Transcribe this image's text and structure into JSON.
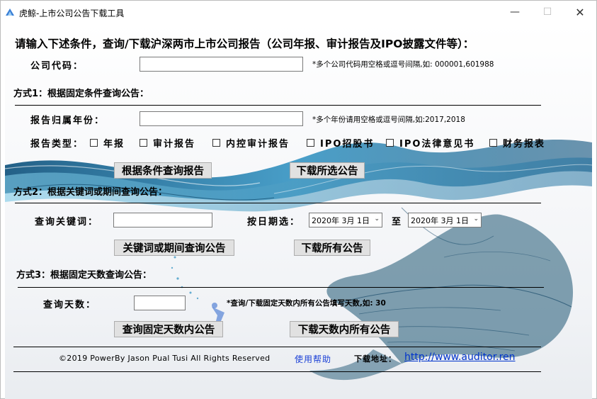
{
  "window": {
    "title": "虎鲸-上市公司公告下载工具",
    "icon": "app-icon",
    "controls": {
      "minimize": "—",
      "maximize": "☐",
      "close": "✕"
    }
  },
  "heading": "请输入下述条件，查询/下载沪深两市上市公司报告（公司年报、审计报告及IPO披露文件等）：",
  "company_code": {
    "label": "公司代码：",
    "value": "",
    "hint": "*多个公司代码用空格或逗号间隔,如: 000001,601988"
  },
  "method1": {
    "title": "方式1：根据固定条件查询公告：",
    "year_label": "报告归属年份：",
    "year_value": "",
    "year_hint": "*多个年份请用空格或逗号间隔,如:2017,2018",
    "type_label": "报告类型：",
    "types": [
      "年报",
      "审计报告",
      "内控审计报告",
      "IPO招股书",
      "IPO法律意见书",
      "财务报表"
    ],
    "query_button": "根据条件查询报告",
    "download_button": "下载所选公告"
  },
  "method2": {
    "title": "方式2：根据关键词或期间查询公告：",
    "keyword_label": "查询关键词：",
    "keyword_value": "",
    "date_label": "按日期选：",
    "date_from": "2020年 3月 1日",
    "date_to": "2020年 3月 1日",
    "to_label": "至",
    "query_button": "关键词或期间查询公告",
    "download_button": "下载所有公告"
  },
  "method3": {
    "title": "方式3：根据固定天数查询公告：",
    "days_label": "查询天数：",
    "days_value": "",
    "days_hint": "*查询/下载固定天数内所有公告填写天数,如: 30",
    "query_button": "查询固定天数内公告",
    "download_button": "下载天数内所有公告"
  },
  "footer": {
    "copyright": "©2019 PowerBy Jason Pual Tusi  All Rights Reserved",
    "help": "使用帮助",
    "download_label": "下载地址：",
    "url": "http://www.auditor.ren"
  },
  "colors": {
    "wave_dark": "#0b4f7a",
    "wave_mid": "#2a8fc0",
    "wave_light": "#7cc9e6",
    "link": "#0033cc"
  }
}
